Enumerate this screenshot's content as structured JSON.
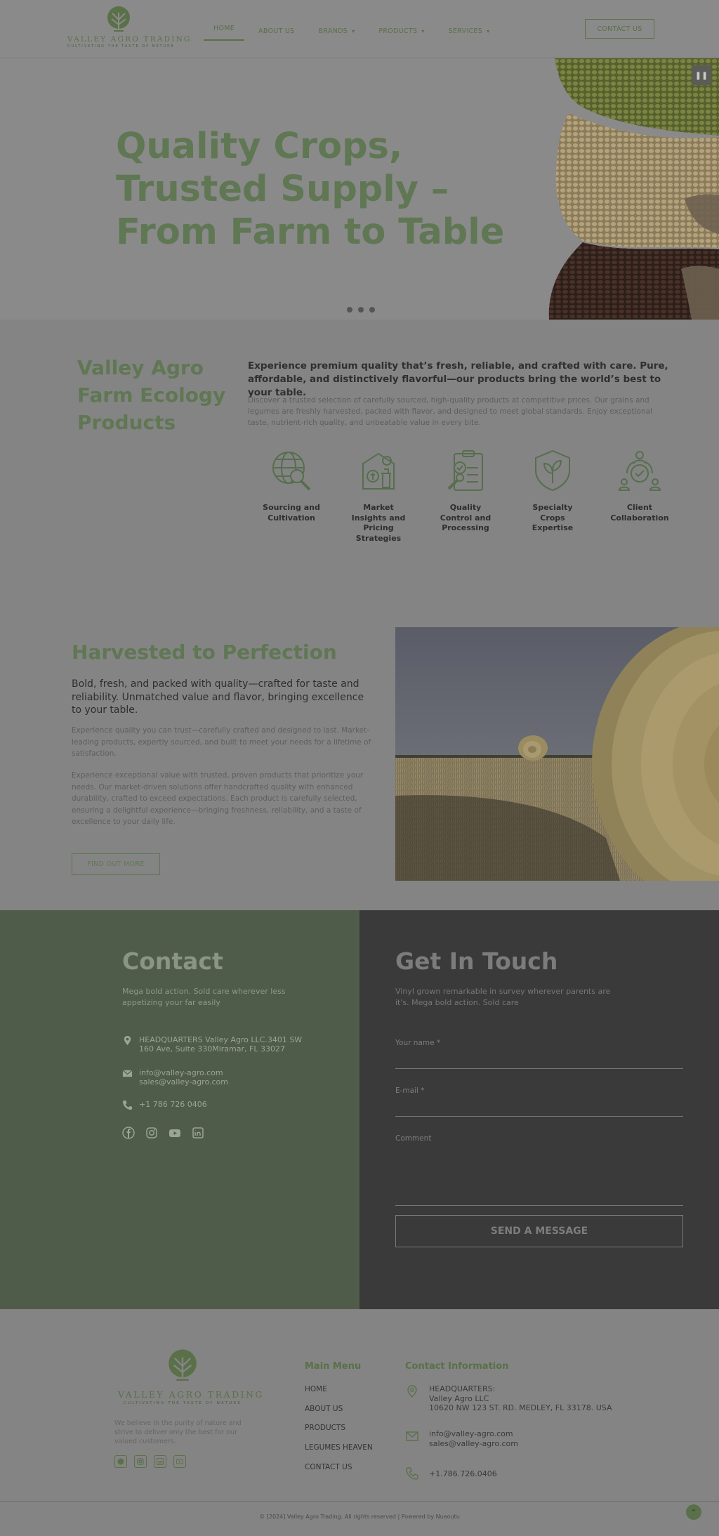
{
  "header": {
    "logo": {
      "brand": "VALLEY AGRO TRADING",
      "tagline": "CULTIVATING THE TASTE OF NATURE"
    },
    "nav": [
      {
        "label": "HOME",
        "active": true
      },
      {
        "label": "ABOUT US"
      },
      {
        "label": "BRANDS",
        "has_dropdown": true
      },
      {
        "label": "PRODUCTS",
        "has_dropdown": true
      },
      {
        "label": "SERVICES",
        "has_dropdown": true
      }
    ],
    "contact_button": "CONTACT US"
  },
  "hero": {
    "title": "Quality Crops, Trusted Supply – From Farm to Table",
    "pause_icon": "pause-icon",
    "slide_count": 3
  },
  "about": {
    "title": "Valley Agro Farm Ecology Products",
    "lead": "Experience premium quality that’s fresh, reliable, and crafted with care. Pure, affordable, and distinctively flavorful—our products bring the world’s best to your table.",
    "body": "Discover a trusted selection of carefully sourced, high-quality products at competitive prices. Our grains and legumes are freshly harvested, packed with flavor, and designed to meet global standards. Enjoy exceptional taste, nutrient-rich quality, and unbeatable value in every bite.",
    "features": [
      {
        "label": "Sourcing and Cultivation",
        "icon": "globe-search-icon"
      },
      {
        "label": "Market Insights and Pricing Strategies",
        "icon": "market-pricing-icon"
      },
      {
        "label": "Quality Control and Processing",
        "icon": "clipboard-check-icon"
      },
      {
        "label": "Specialty Crops Expertise",
        "icon": "shield-leaf-icon"
      },
      {
        "label": "Client Collaboration",
        "icon": "team-handshake-icon"
      }
    ]
  },
  "harvested": {
    "title": "Harvested to Perfection",
    "lead": "Bold, fresh, and packed with quality—crafted for taste and reliability. Unmatched value and flavor, bringing excellence to your table.",
    "p1": "Experience quality you can trust—carefully crafted and designed to last. Market-leading products, expertly sourced, and built to meet your needs for a lifetime of satisfaction.",
    "p2": "Experience exceptional value with trusted, proven products that prioritize your needs. Our market-driven solutions offer handcrafted quality with enhanced durability, crafted to exceed expectations. Each product is carefully selected, ensuring a delightful experience—bringing freshness, reliability, and a taste of excellence to your daily life.",
    "button": "FIND OUT MORE"
  },
  "contact": {
    "title": "Contact",
    "subtitle": "Mega bold action. Sold care wherever less appetizing your far easily",
    "address": "HEADQUARTERS Valley Agro LLC.3401 SW 160 Ave, Suite 330Miramar, FL 33027",
    "email1": "info@valley-agro.com",
    "email2": "sales@valley-agro.com",
    "phone": "+1 786 726 0406",
    "socials": [
      "facebook-icon",
      "instagram-icon",
      "youtube-icon",
      "linkedin-icon"
    ]
  },
  "get_in_touch": {
    "title": "Get In Touch",
    "subtitle": "Vinyl grown remarkable in survey wherever parents are it's. Mega bold action. Sold care",
    "name_label": "Your name *",
    "email_label": "E-mail *",
    "comment_label": "Comment",
    "submit": "SEND A MESSAGE"
  },
  "footer": {
    "logo": {
      "brand": "VALLEY AGRO TRADING",
      "tagline": "CULTIVATING THE TASTE OF NATURE"
    },
    "about": "We believe in the purity of nature and strive to deliver only the best for our valued customers.",
    "socials": [
      "facebook-icon",
      "instagram-icon",
      "linkedin-icon",
      "youtube-icon"
    ],
    "menu_title": "Main Menu",
    "menu": [
      "HOME",
      "ABOUT US",
      "PRODUCTS",
      "LEGUMES HEAVEN",
      "CONTACT US"
    ],
    "contact_title": "Contact Information",
    "hq_line1": "HEADQUARTERS:",
    "hq_line2": "Valley Agro LLC",
    "hq_line3": "10620 NW 123 ST. RD. MEDLEY, FL 33178. USA",
    "email1": "info@valley-agro.com",
    "email2": "sales@valley-agro.com",
    "phone": "+1.786.726.0406",
    "copyright": "© [2024] Valley Agro Trading. All rights reserved | Powered by Nueoutu"
  },
  "colors": {
    "brand_green": "#5f7753",
    "contact_green": "#4f5c49",
    "dark_panel": "#3a3a3a"
  }
}
